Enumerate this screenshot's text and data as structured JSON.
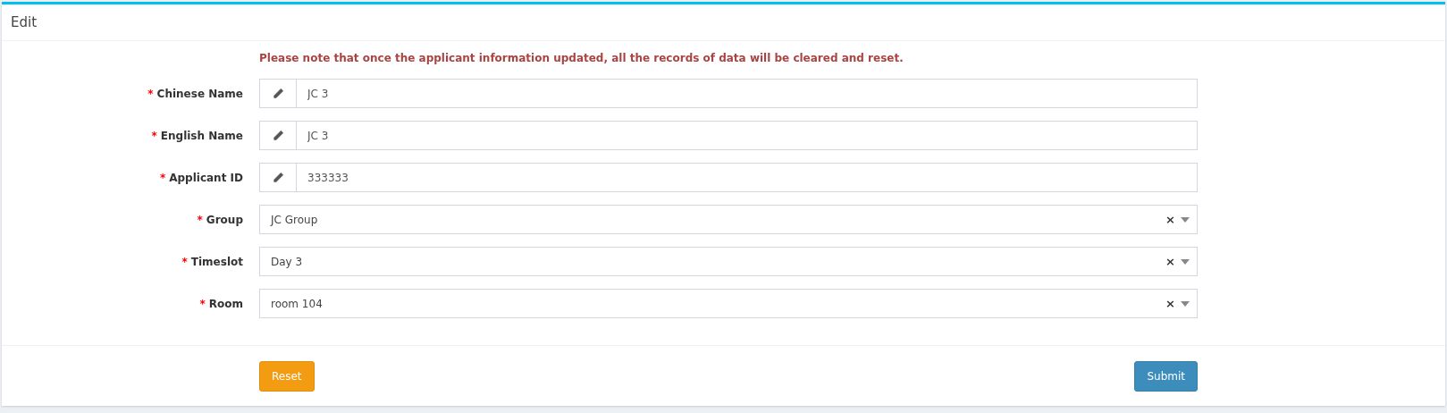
{
  "panel": {
    "title": "Edit"
  },
  "notice": "Please note that once the applicant information updated, all the records of data will be cleared and reset.",
  "fields": [
    {
      "kind": "text",
      "required_mark": "*",
      "label": "Chinese Name",
      "value": "JC 3"
    },
    {
      "kind": "text",
      "required_mark": "*",
      "label": "English Name",
      "value": "JC 3"
    },
    {
      "kind": "text",
      "required_mark": "*",
      "label": "Applicant ID",
      "value": "333333"
    },
    {
      "kind": "select",
      "required_mark": "*",
      "label": "Group",
      "value": "JC Group",
      "clear": "×"
    },
    {
      "kind": "select",
      "required_mark": "*",
      "label": "Timeslot",
      "value": "Day 3",
      "clear": "×"
    },
    {
      "kind": "select",
      "required_mark": "*",
      "label": "Room",
      "value": "room 104",
      "clear": "×"
    }
  ],
  "buttons": {
    "reset": "Reset",
    "submit": "Submit"
  }
}
